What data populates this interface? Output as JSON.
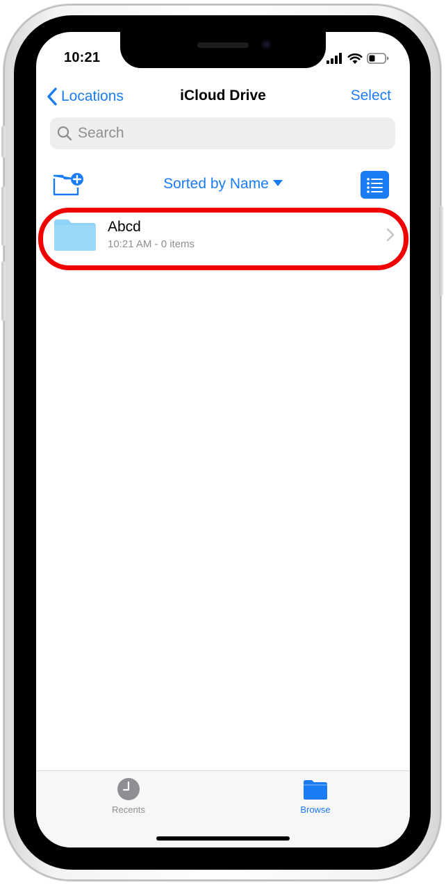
{
  "status_bar": {
    "time": "10:21",
    "icons": [
      "signal-icon",
      "wifi-icon",
      "battery-icon"
    ]
  },
  "nav": {
    "back_label": "Locations",
    "title": "iCloud Drive",
    "select_label": "Select"
  },
  "search": {
    "placeholder": "Search"
  },
  "toolbar": {
    "new_folder_icon": "new-folder-icon",
    "sort_label": "Sorted by Name",
    "view_icon": "list-view-icon"
  },
  "files": [
    {
      "name": "Abcd",
      "meta": "10:21 AM - 0 items",
      "icon": "folder-icon",
      "highlighted": true
    }
  ],
  "tabs": [
    {
      "label": "Recents",
      "icon": "clock-icon",
      "active": false
    },
    {
      "label": "Browse",
      "icon": "folder-icon",
      "active": true
    }
  ],
  "colors": {
    "accent": "#1a7cf5",
    "highlight": "#f10000",
    "folder": "#8fd3f8",
    "inactive_tab": "#8e8e93"
  }
}
